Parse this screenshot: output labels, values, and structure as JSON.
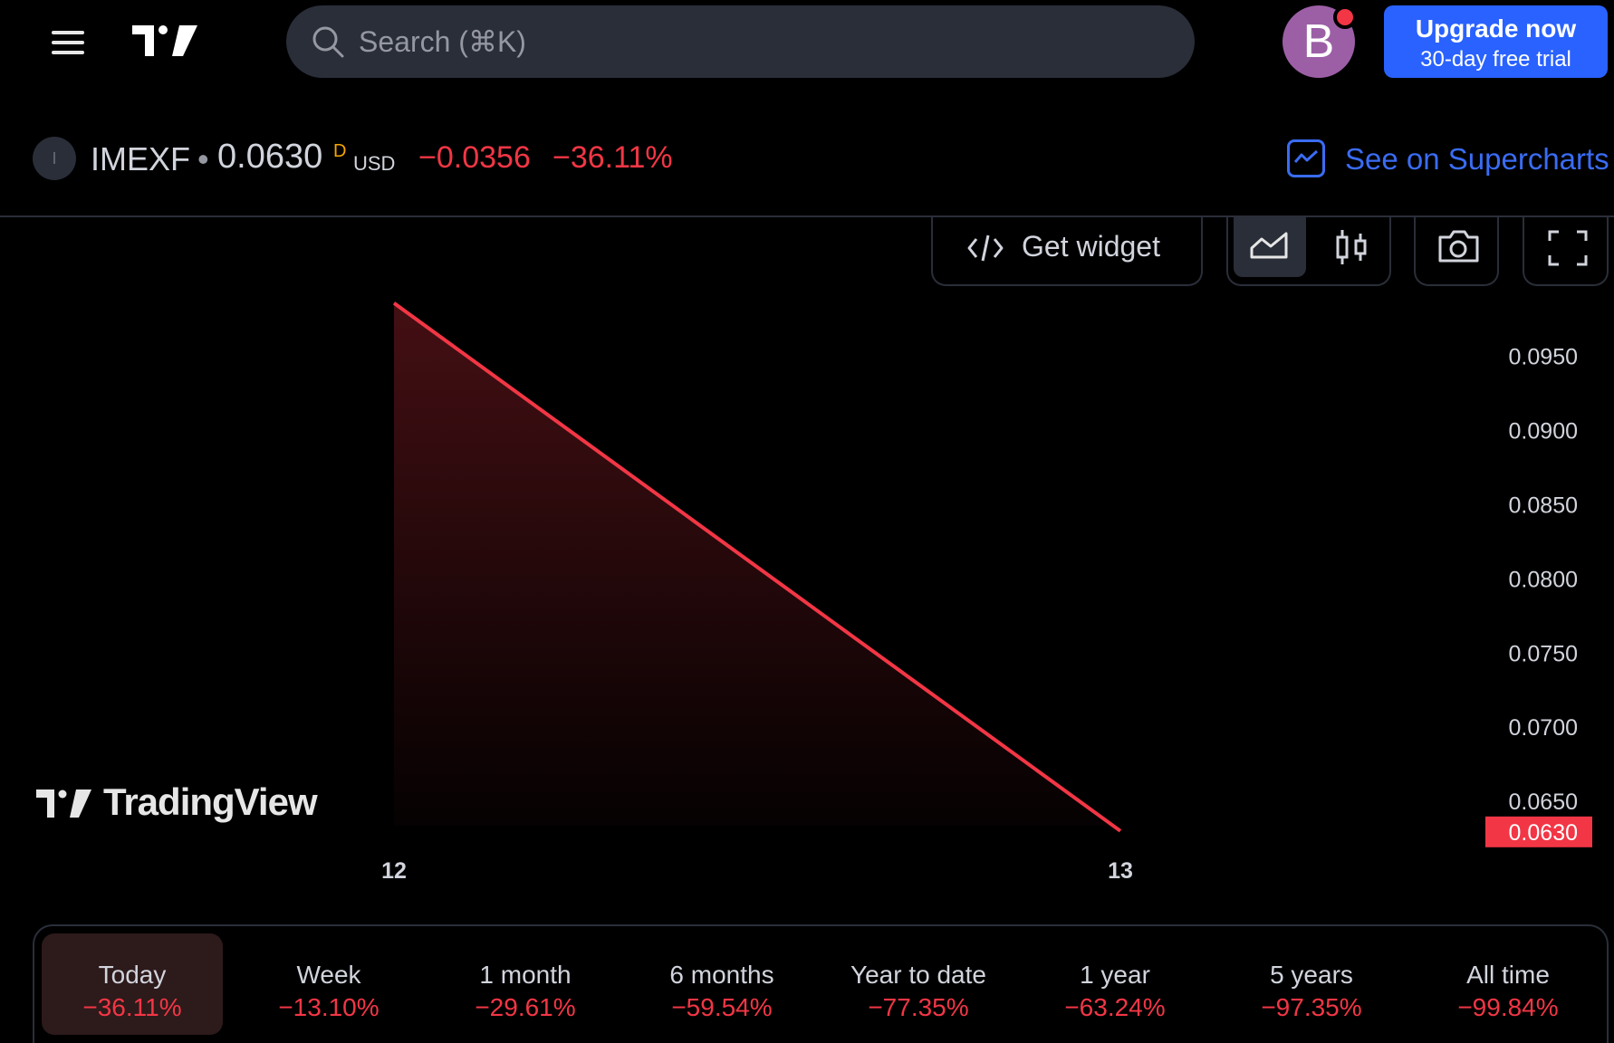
{
  "header": {
    "menu_icon": "hamburger-menu-icon",
    "logo_icon": "tradingview-logo-icon",
    "search": {
      "placeholder": "Search (⌘K)",
      "value": ""
    },
    "avatar_letter": "B",
    "upgrade": {
      "title": "Upgrade now",
      "subtitle": "30-day free trial"
    },
    "colors": {
      "brand_blue": "#2962ff",
      "avatar_purple": "#9c5fa6",
      "notification_red": "#f23645"
    }
  },
  "symbol": {
    "icon_letter": "I",
    "ticker": "IMEXF",
    "separator": "•",
    "price": "0.0630",
    "price_flag": "D",
    "currency": "USD",
    "change": "−0.0356",
    "change_percent": "−36.11%",
    "supercharts_link": "See on Supercharts"
  },
  "toolbar": {
    "widget_label": "Get widget",
    "widget_icon": "code-icon",
    "area_chart_icon": "area-chart-icon",
    "candle_chart_icon": "candlestick-chart-icon",
    "snapshot_icon": "camera-icon",
    "fullscreen_icon": "fullscreen-icon",
    "selected_chart_type": "area"
  },
  "watermark": "TradingView",
  "chart_data": {
    "type": "area",
    "x": [
      "12",
      "13"
    ],
    "values": [
      0.0986,
      0.063
    ],
    "x_ticks": [
      "12",
      "13"
    ],
    "y_ticks": [
      "0.0950",
      "0.0900",
      "0.0850",
      "0.0800",
      "0.0750",
      "0.0700",
      "0.0650"
    ],
    "ylim": [
      0.0625,
      0.0995
    ],
    "last_price_label": "0.0630",
    "line_color": "#f23645",
    "grid": false
  },
  "periods": [
    {
      "label": "Today",
      "value": "−36.11%",
      "active": true
    },
    {
      "label": "Week",
      "value": "−13.10%",
      "active": false
    },
    {
      "label": "1 month",
      "value": "−29.61%",
      "active": false
    },
    {
      "label": "6 months",
      "value": "−59.54%",
      "active": false
    },
    {
      "label": "Year to date",
      "value": "−77.35%",
      "active": false
    },
    {
      "label": "1 year",
      "value": "−63.24%",
      "active": false
    },
    {
      "label": "5 years",
      "value": "−97.35%",
      "active": false
    },
    {
      "label": "All time",
      "value": "−99.84%",
      "active": false
    }
  ]
}
